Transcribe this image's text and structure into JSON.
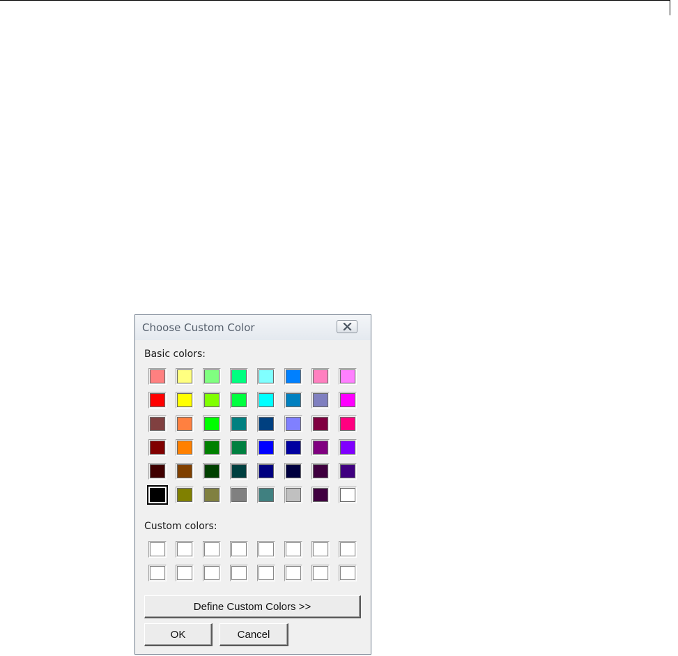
{
  "dialog": {
    "title": "Choose Custom Color",
    "close_icon": "close-x-icon",
    "basic_colors_label": "Basic colors:",
    "custom_colors_label": "Custom colors:",
    "define_button_label": "Define Custom Colors >>",
    "ok_button_label": "OK",
    "cancel_button_label": "Cancel",
    "selected_basic_color": "#000000"
  },
  "basic_colors": [
    [
      "#ff8080",
      "#ffff80",
      "#80ff80",
      "#00ff80",
      "#80ffff",
      "#0080ff",
      "#ff80c0",
      "#ff80ff"
    ],
    [
      "#ff0000",
      "#ffff00",
      "#80ff00",
      "#00ff40",
      "#00ffff",
      "#0080c0",
      "#8080c0",
      "#ff00ff"
    ],
    [
      "#804040",
      "#ff8040",
      "#00ff00",
      "#008080",
      "#004080",
      "#8080ff",
      "#800040",
      "#ff0080"
    ],
    [
      "#800000",
      "#ff8000",
      "#008000",
      "#008040",
      "#0000ff",
      "#0000a0",
      "#800080",
      "#8000ff"
    ],
    [
      "#400000",
      "#804000",
      "#004000",
      "#004040",
      "#000080",
      "#000040",
      "#400040",
      "#400080"
    ],
    [
      "#000000",
      "#808000",
      "#808040",
      "#808080",
      "#408080",
      "#c0c0c0",
      "#400040",
      "#ffffff"
    ]
  ],
  "custom_colors": [
    [
      "#ffffff",
      "#ffffff",
      "#ffffff",
      "#ffffff",
      "#ffffff",
      "#ffffff",
      "#ffffff",
      "#ffffff"
    ],
    [
      "#ffffff",
      "#ffffff",
      "#ffffff",
      "#ffffff",
      "#ffffff",
      "#ffffff",
      "#ffffff",
      "#ffffff"
    ]
  ]
}
